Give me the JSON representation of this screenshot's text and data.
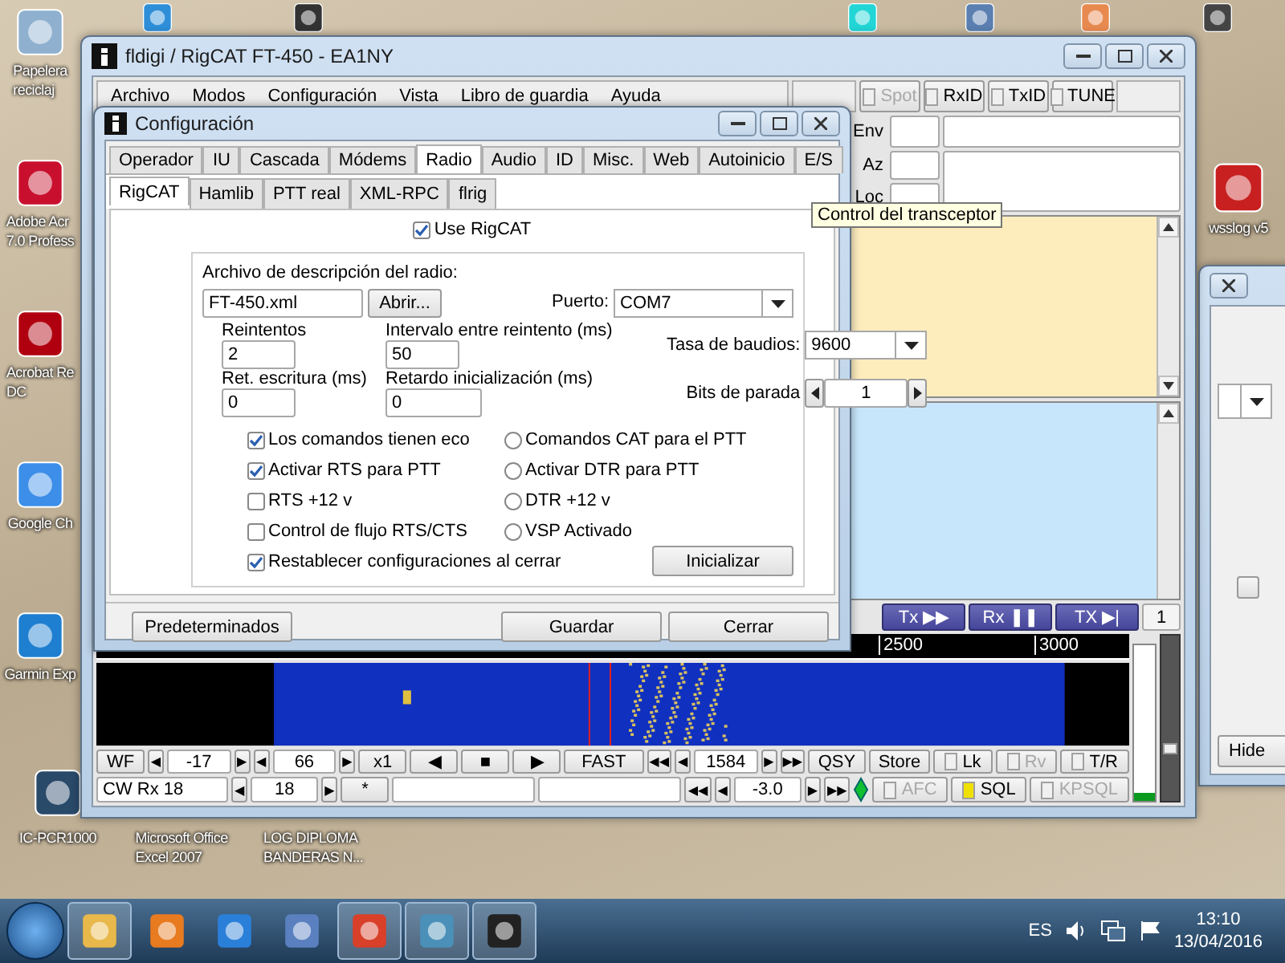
{
  "desktop": {
    "icons_left": [
      {
        "lines": [
          "Papelera",
          "reciclaj"
        ]
      },
      {
        "lines": [
          "Adobe Acr",
          "7.0 Profess"
        ]
      },
      {
        "lines": [
          "Acrobat Re",
          "DC"
        ]
      },
      {
        "lines": [
          "Google Ch"
        ]
      },
      {
        "lines": [
          "Garmin Exp"
        ]
      }
    ],
    "icons_bottom": [
      {
        "lines": [
          "IC-PCR1000"
        ]
      },
      {
        "lines": [
          "Microsoft Office",
          "Excel 2007"
        ]
      },
      {
        "lines": [
          "LOG DIPLOMA",
          "BANDERAS N..."
        ]
      }
    ],
    "icons_right": [
      {
        "lines": [
          "wsslog v5"
        ]
      }
    ]
  },
  "main_window": {
    "title": "fldigi / RigCAT FT-450 - EA1NY",
    "menu": [
      "Archivo",
      "Modos",
      "Configuración",
      "Vista",
      "Libro de guardia",
      "Ayuda"
    ],
    "toolbar": [
      {
        "label": "Spot",
        "checked": false,
        "disabled": true
      },
      {
        "label": "RxID",
        "checked": false,
        "disabled": false
      },
      {
        "label": "TxID",
        "checked": false,
        "disabled": false
      },
      {
        "label": "TUNE",
        "checked": false,
        "disabled": false
      }
    ],
    "fields": [
      {
        "label": "Env"
      },
      {
        "label": "Az"
      },
      {
        "label": "Loc"
      }
    ],
    "mode_buttons": [
      "Tx ▶▶",
      "Rx ❚❚",
      "TX ▶|"
    ],
    "channel": "1",
    "scale": [
      "2500",
      "3000"
    ],
    "meter": {
      "level": 0.05
    },
    "slider": {
      "level": 0.28
    },
    "control_rows": [
      {
        "items": [
          {
            "kind": "button",
            "label": "WF"
          },
          {
            "kind": "arrow",
            "label": "◀"
          },
          {
            "kind": "field",
            "label": "-17"
          },
          {
            "kind": "arrow",
            "label": "▶"
          },
          {
            "kind": "arrow",
            "label": "◀"
          },
          {
            "kind": "field",
            "label": "66"
          },
          {
            "kind": "arrow",
            "label": "▶"
          },
          {
            "kind": "button",
            "label": "x1"
          },
          {
            "kind": "button",
            "label": "◀"
          },
          {
            "kind": "button",
            "label": "■"
          },
          {
            "kind": "button",
            "label": "▶"
          },
          {
            "kind": "wide_button",
            "label": "FAST"
          },
          {
            "kind": "arrow",
            "label": "◀◀"
          },
          {
            "kind": "arrow",
            "label": "◀"
          },
          {
            "kind": "field",
            "label": "1584"
          },
          {
            "kind": "arrow",
            "label": "▶"
          },
          {
            "kind": "arrow",
            "label": "▶▶"
          },
          {
            "kind": "button",
            "label": "QSY"
          },
          {
            "kind": "button",
            "label": "Store"
          },
          {
            "kind": "toggle",
            "label": "Lk",
            "checked": false,
            "disabled": false
          },
          {
            "kind": "toggle",
            "label": "Rv",
            "checked": false,
            "disabled": true
          },
          {
            "kind": "toggle",
            "label": "T/R",
            "checked": false,
            "disabled": false
          }
        ]
      },
      {
        "items": [
          {
            "kind": "wide_field",
            "label": "CW   Rx 18"
          },
          {
            "kind": "arrow",
            "label": "◀"
          },
          {
            "kind": "field",
            "label": "18"
          },
          {
            "kind": "arrow",
            "label": "▶"
          },
          {
            "kind": "button",
            "label": "*"
          },
          {
            "kind": "blank"
          },
          {
            "kind": "blank"
          },
          {
            "kind": "arrow",
            "label": "◀◀"
          },
          {
            "kind": "arrow",
            "label": "◀"
          },
          {
            "kind": "field",
            "label": "-3.0"
          },
          {
            "kind": "arrow",
            "label": "▶"
          },
          {
            "kind": "arrow",
            "label": "▶▶"
          },
          {
            "kind": "indicator",
            "on": true
          },
          {
            "kind": "toggle",
            "label": "AFC",
            "checked": false,
            "disabled": true
          },
          {
            "kind": "toggle",
            "label": "SQL",
            "checked": true,
            "disabled": false
          },
          {
            "kind": "toggle",
            "label": "KPSQL",
            "checked": false,
            "disabled": true
          }
        ]
      }
    ]
  },
  "config_dialog": {
    "title": "Configuración",
    "tabs": [
      {
        "label": "Operador",
        "selected": false
      },
      {
        "label": "IU",
        "selected": false
      },
      {
        "label": "Cascada",
        "selected": false
      },
      {
        "label": "Módems",
        "selected": false
      },
      {
        "label": "Radio",
        "selected": true
      },
      {
        "label": "Audio",
        "selected": false
      },
      {
        "label": "ID",
        "selected": false
      },
      {
        "label": "Misc.",
        "selected": false
      },
      {
        "label": "Web",
        "selected": false
      },
      {
        "label": "Autoinicio",
        "selected": false
      },
      {
        "label": "E/S",
        "selected": false
      }
    ],
    "subtabs": [
      {
        "label": "RigCAT",
        "selected": true
      },
      {
        "label": "Hamlib",
        "selected": false
      },
      {
        "label": "PTT real",
        "selected": false
      },
      {
        "label": "XML-RPC",
        "selected": false
      },
      {
        "label": "flrig",
        "selected": false
      }
    ],
    "use_rigcat": {
      "label": "Use RigCAT",
      "checked": true
    },
    "file_label": "Archivo de descripción del radio:",
    "file": "FT-450.xml",
    "open_button": "Abrir...",
    "port": {
      "label": "Puerto:",
      "value": "COM7"
    },
    "retries": {
      "label": "Reintentos",
      "value": "2"
    },
    "retry_interval": {
      "label": "Intervalo entre reintento (ms)",
      "value": "50"
    },
    "baud": {
      "label": "Tasa de baudios:",
      "value": "9600"
    },
    "write_delay": {
      "label": "Ret. escritura (ms)",
      "value": "0"
    },
    "init_delay": {
      "label": "Retardo inicialización (ms)",
      "value": "0"
    },
    "stop_bits": {
      "label": "Bits de parada",
      "value": "1"
    },
    "checks_left": [
      {
        "label": "Los comandos tienen eco",
        "checked": true
      },
      {
        "label": "Activar RTS para PTT",
        "checked": true
      },
      {
        "label": "RTS +12 v",
        "checked": false
      },
      {
        "label": "Control de flujo RTS/CTS",
        "checked": false
      },
      {
        "label": "Restablecer configuraciones al cerrar",
        "checked": true
      }
    ],
    "checks_right": [
      {
        "label": "Comandos CAT para el PTT",
        "checked": false
      },
      {
        "label": "Activar DTR para PTT",
        "checked": false
      },
      {
        "label": "DTR +12 v",
        "checked": false
      },
      {
        "label": "VSP Activado",
        "checked": false
      }
    ],
    "init_button": "Inicializar",
    "buttons": [
      "Predeterminados",
      "Guardar",
      "Cerrar"
    ]
  },
  "tooltip": "Control del transceptor",
  "side_window": {
    "button": "Hide"
  },
  "taskbar": {
    "apps": [
      {
        "running": true
      },
      {
        "running": false
      },
      {
        "running": false
      },
      {
        "running": false
      },
      {
        "running": true
      },
      {
        "running": true
      },
      {
        "running": true
      }
    ],
    "language": "ES",
    "time": "13:10",
    "date": "13/04/2016"
  }
}
